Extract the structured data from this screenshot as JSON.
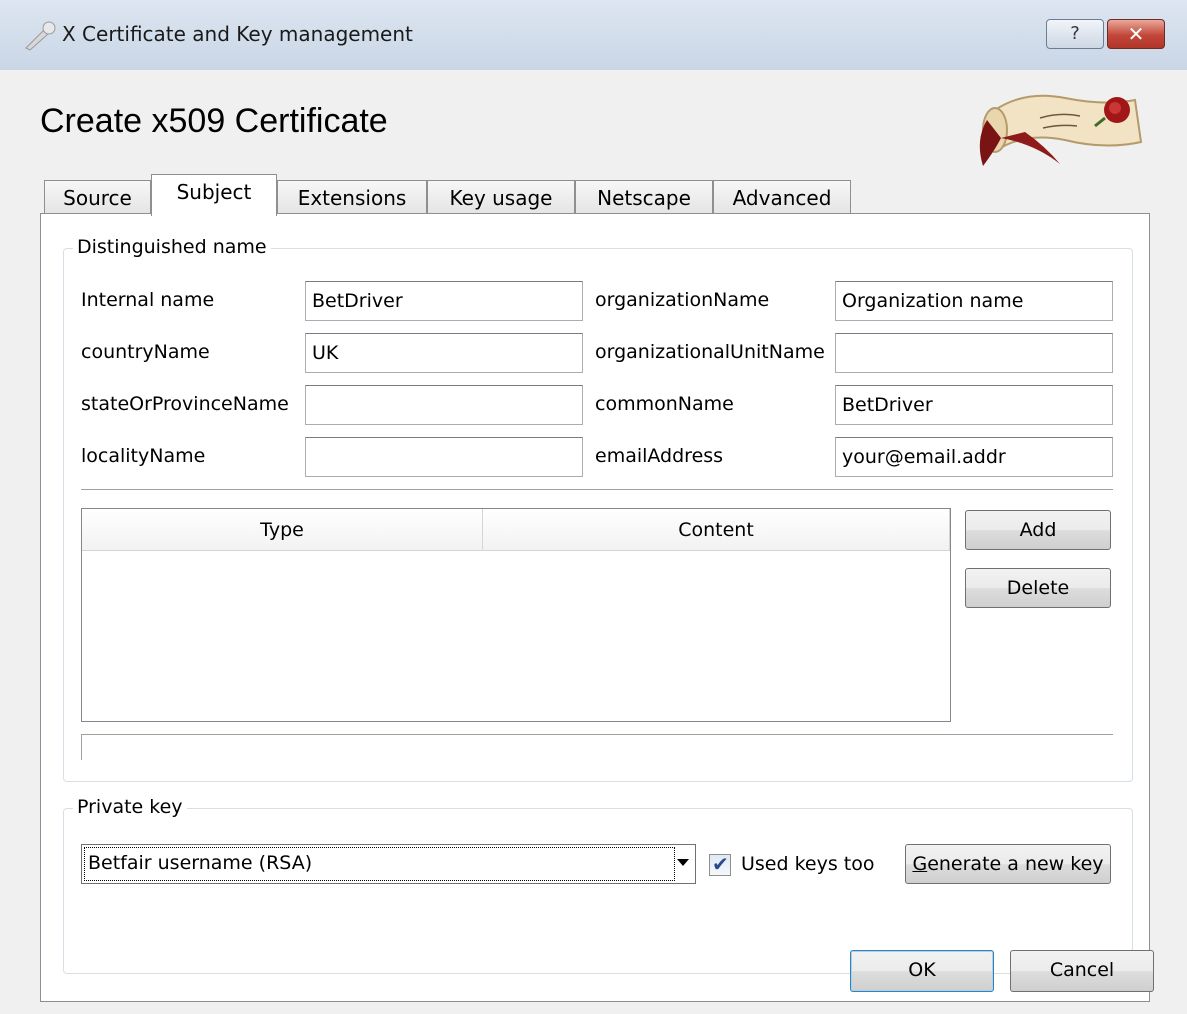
{
  "window": {
    "title": "X Certificate and Key management",
    "help_label": "?",
    "close_label": "✕"
  },
  "page_title": "Create x509 Certificate",
  "tabs": [
    {
      "label": "Source"
    },
    {
      "label": "Subject"
    },
    {
      "label": "Extensions"
    },
    {
      "label": "Key usage"
    },
    {
      "label": "Netscape"
    },
    {
      "label": "Advanced"
    }
  ],
  "active_tab": "Subject",
  "distinguished": {
    "title": "Distinguished name",
    "fields": [
      {
        "label": "Internal name",
        "value": "BetDriver"
      },
      {
        "label": "countryName",
        "value": "UK"
      },
      {
        "label": "stateOrProvinceName",
        "value": ""
      },
      {
        "label": "localityName",
        "value": ""
      },
      {
        "label": "organizationName",
        "value": "Organization name"
      },
      {
        "label": "organizationalUnitName",
        "value": ""
      },
      {
        "label": "commonName",
        "value": "BetDriver"
      },
      {
        "label": "emailAddress",
        "value": "your@email.addr"
      }
    ],
    "table": {
      "columns": [
        "Type",
        "Content"
      ],
      "rows": []
    },
    "add_label": "Add",
    "delete_label": "Delete"
  },
  "private_key": {
    "title": "Private key",
    "selected": "Betfair username (RSA)",
    "used_keys_label": "Used keys too",
    "used_keys_checked": true,
    "generate_label": "Generate a new key",
    "generate_mnemonic": "G",
    "generate_rest": "enerate a new key"
  },
  "footer": {
    "ok_label": "OK",
    "cancel_label": "Cancel"
  }
}
